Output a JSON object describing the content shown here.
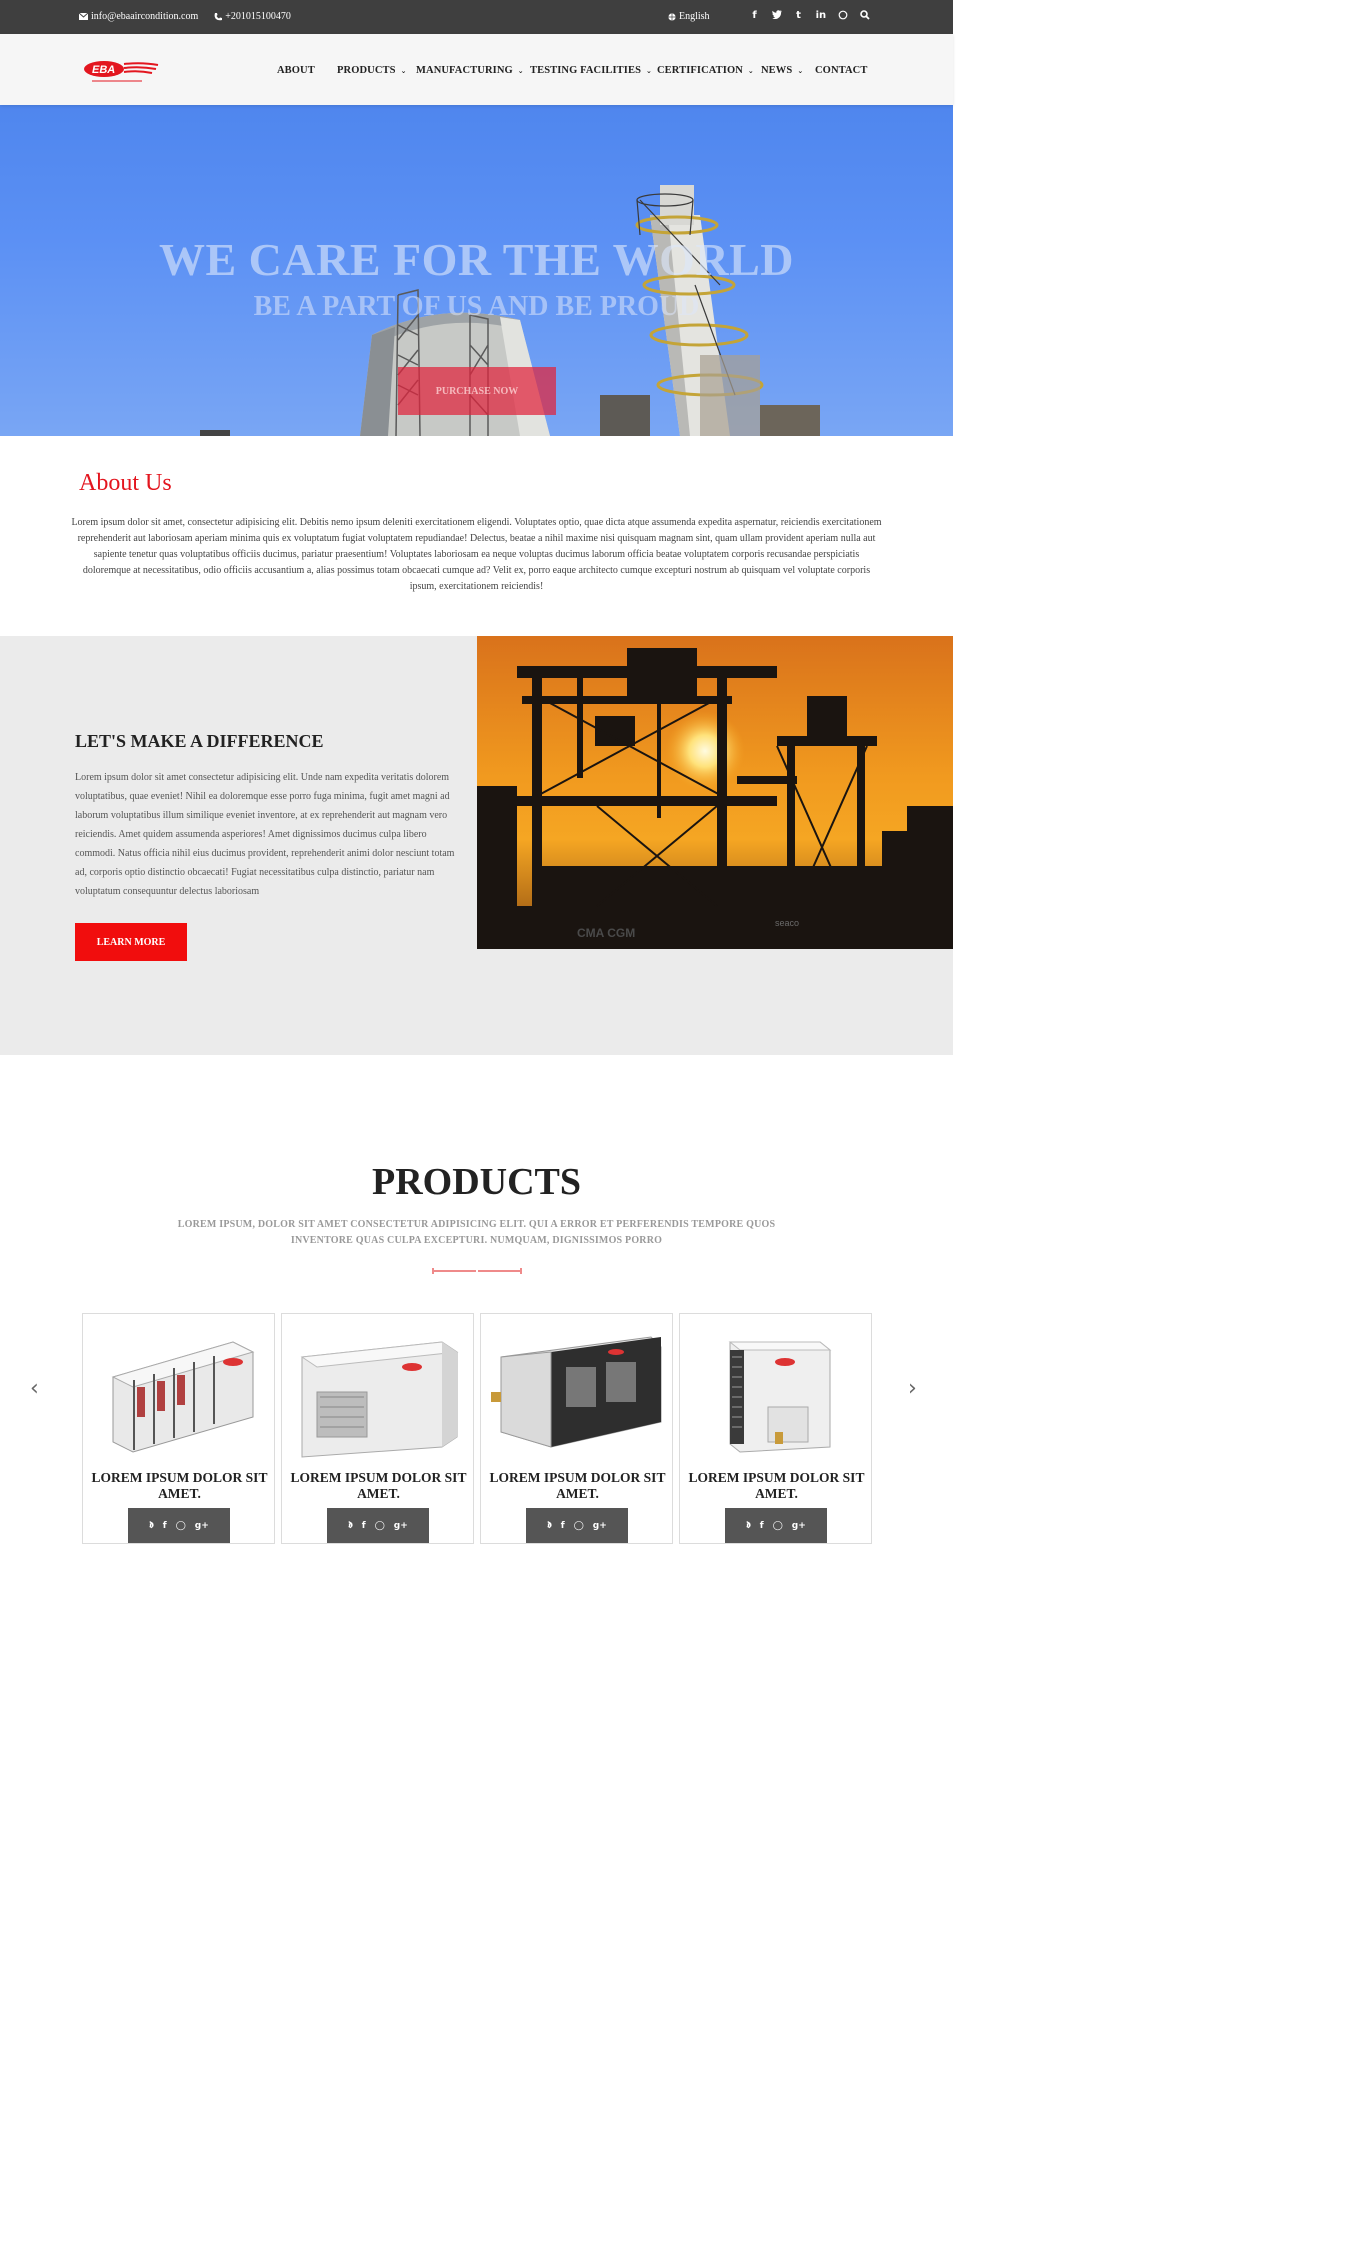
{
  "topbar": {
    "email": "info@ebaaircondition.com",
    "phone": "+201015100470",
    "language": "English",
    "social": [
      "f",
      "t",
      "t",
      "in",
      "w",
      "search"
    ]
  },
  "logo": {
    "text": "EBA"
  },
  "nav": [
    {
      "label": "ABOUT",
      "dropdown": false
    },
    {
      "label": "PRODUCTS",
      "dropdown": true
    },
    {
      "label": "MANUFACTURING",
      "dropdown": true
    },
    {
      "label": "TESTING FACILITIES",
      "dropdown": true
    },
    {
      "label": "CERTIFICATION",
      "dropdown": true
    },
    {
      "label": "NEWS",
      "dropdown": true
    },
    {
      "label": "CONTACT",
      "dropdown": false
    }
  ],
  "hero": {
    "title": "WE CARE FOR THE WORLD",
    "subtitle": "BE A PART OF US AND BE PROUD",
    "cta": "PURCHASE NOW"
  },
  "about": {
    "title": "About Us",
    "body": "Lorem ipsum dolor sit amet, consectetur adipisicing elit. Debitis nemo ipsum deleniti exercitationem eligendi. Voluptates optio, quae dicta atque assumenda expedita aspernatur, reiciendis exercitationem reprehenderit aut laboriosam aperiam minima quis ex voluptatum fugiat voluptatem repudiandae! Delectus, beatae a nihil maxime nisi quisquam magnam sint, quam ullam provident aperiam nulla aut sapiente tenetur quas voluptatibus officiis ducimus, pariatur praesentium! Voluptates laboriosam ea neque voluptas ducimus laborum officia beatae voluptatem corporis recusandae perspiciatis doloremque at necessitatibus, odio officiis accusantium a, alias possimus totam obcaecati cumque ad? Velit ex, porro eaque architecto cumque excepturi nostrum ab quisquam vel voluptate corporis ipsum, exercitationem reiciendis!"
  },
  "difference": {
    "title": "LET'S MAKE A DIFFERENCE",
    "body": "Lorem ipsum dolor sit amet consectetur adipisicing elit. Unde nam expedita veritatis dolorem voluptatibus, quae eveniet! Nihil ea doloremque esse porro fuga minima, fugit amet magni ad laborum voluptatibus illum similique eveniet inventore, at ex reprehenderit aut magnam vero reiciendis. Amet quidem assumenda asperiores! Amet dignissimos ducimus culpa libero commodi. Natus officia nihil eius ducimus provident, reprehenderit animi dolor nesciunt totam ad, corporis optio distinctio obcaecati! Fugiat necessitatibus culpa distinctio, pariatur nam voluptatum consequuntur delectus laboriosam",
    "button": "LEARN MORE",
    "image_text": [
      "CMA CGM",
      "seaco"
    ]
  },
  "products": {
    "title": "PRODUCTS",
    "subtitle": "LOREM IPSUM, DOLOR SIT AMET CONSECTETUR ADIPISICING ELIT. QUI A ERROR ET PERFERENDIS TEMPORE QUOS INVENTORE QUAS CULPA EXCEPTURI. NUMQUAM, DIGNISSIMOS PORRO",
    "items": [
      {
        "title": "LOREM IPSUM DOLOR SIT AMET.",
        "share": [
          "twitter",
          "facebook",
          "dribbble",
          "google-plus"
        ]
      },
      {
        "title": "LOREM IPSUM DOLOR SIT AMET.",
        "share": [
          "twitter",
          "facebook",
          "dribbble",
          "google-plus"
        ]
      },
      {
        "title": "LOREM IPSUM DOLOR SIT AMET.",
        "share": [
          "twitter",
          "facebook",
          "dribbble",
          "google-plus"
        ]
      },
      {
        "title": "LOREM IPSUM DOLOR SIT AMET.",
        "share": [
          "twitter",
          "facebook",
          "dribbble",
          "google-plus"
        ]
      }
    ],
    "prev": "‹",
    "next": "›"
  },
  "colors": {
    "accent": "#e3161f",
    "button_red": "#f10d0d",
    "topbar": "#3f3f3f"
  }
}
